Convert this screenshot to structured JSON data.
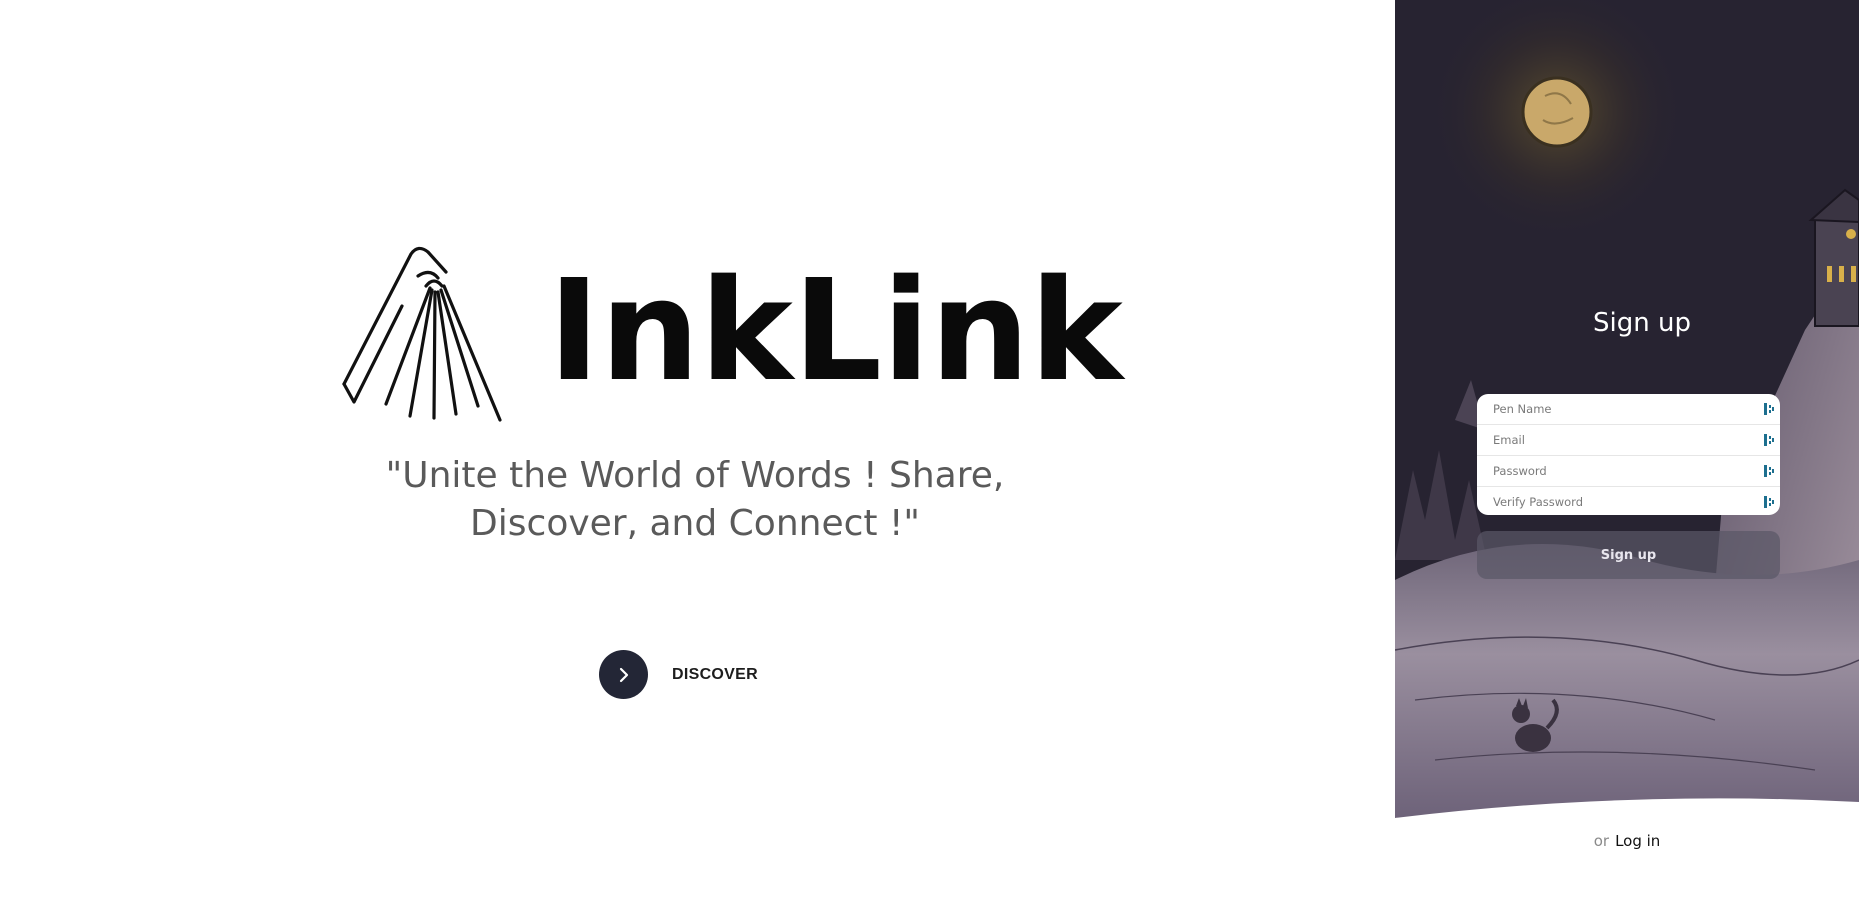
{
  "hero": {
    "brand_name": "InkLink",
    "tagline": "\"Unite the World of Words ! Share, Discover, and Connect !\"",
    "discover_label": "DISCOVER",
    "logo_icon": "open-book-icon",
    "discover_icon": "chevron-right-icon"
  },
  "signup": {
    "title": "Sign up",
    "fields": [
      {
        "placeholder": "Pen Name",
        "icon": "password-manager-icon"
      },
      {
        "placeholder": "Email",
        "icon": "password-manager-icon"
      },
      {
        "placeholder": "Password",
        "icon": "password-manager-icon"
      },
      {
        "placeholder": "Verify Password",
        "icon": "password-manager-icon"
      }
    ],
    "button_label": "Sign up",
    "alt_prefix": "or",
    "alt_link": "Log in"
  },
  "colors": {
    "sky": "#272331",
    "moon": "#c9a86a",
    "hill": "#8e8497",
    "button_dark": "#232636",
    "icon_accent": "#1d6f8f"
  }
}
